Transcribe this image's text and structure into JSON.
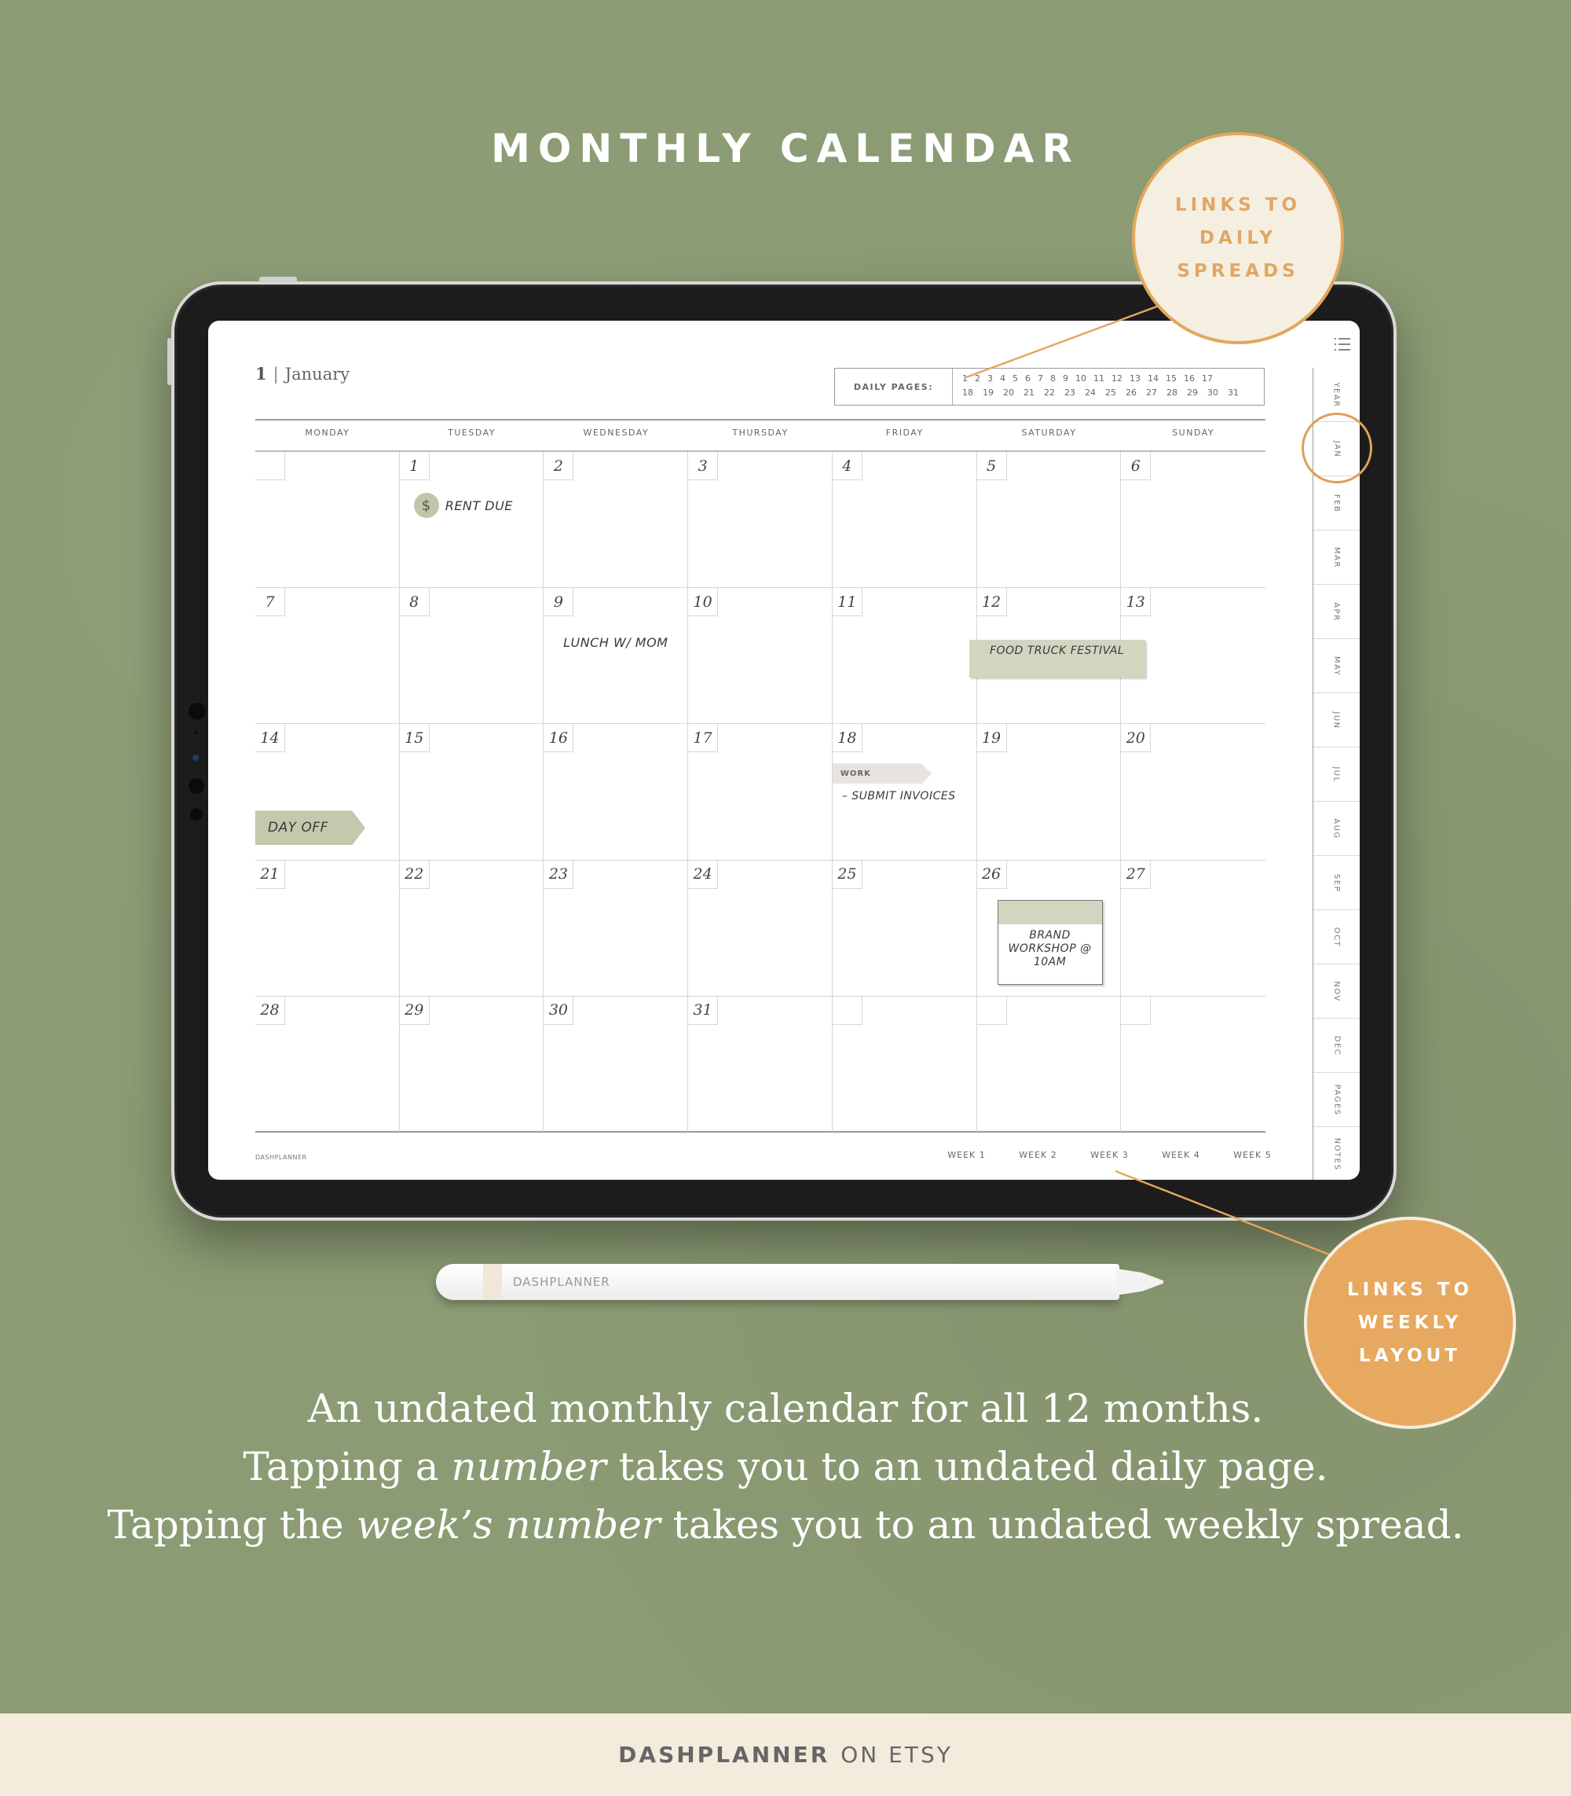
{
  "header": {
    "title": "MONTHLY CALENDAR"
  },
  "colors": {
    "background": "#8b9b73",
    "accent_orange": "#e6a95f",
    "cream": "#f5efe1",
    "sage_tag": "#c5c8ac",
    "footer_bg": "#f3ecdc"
  },
  "planner": {
    "month_number": "1",
    "month_separator": "|",
    "month_name": "January",
    "daily_pages_label": "DAILY PAGES:",
    "daily_pages_row1": [
      "1",
      "2",
      "3",
      "4",
      "5",
      "6",
      "7",
      "8",
      "9",
      "10",
      "11",
      "12",
      "13",
      "14",
      "15",
      "16",
      "17"
    ],
    "daily_pages_row2": [
      "18",
      "19",
      "20",
      "21",
      "22",
      "23",
      "24",
      "25",
      "26",
      "27",
      "28",
      "29",
      "30",
      "31"
    ],
    "weekdays": [
      "MONDAY",
      "TUESDAY",
      "WEDNESDAY",
      "THURSDAY",
      "FRIDAY",
      "SATURDAY",
      "SUNDAY"
    ],
    "days": [
      "",
      "1",
      "2",
      "3",
      "4",
      "5",
      "6",
      "7",
      "8",
      "9",
      "10",
      "11",
      "12",
      "13",
      "14",
      "15",
      "16",
      "17",
      "18",
      "19",
      "20",
      "21",
      "22",
      "23",
      "24",
      "25",
      "26",
      "27",
      "28",
      "29",
      "30",
      "31",
      "",
      "",
      ""
    ],
    "events": {
      "rent_due": {
        "day": "1",
        "icon": "dollar-icon",
        "icon_glyph": "$",
        "text": "RENT DUE"
      },
      "lunch": {
        "day": "9",
        "text": "LUNCH W/ MOM"
      },
      "food_truck": {
        "day": "12",
        "text": "FOOD TRUCK FESTIVAL"
      },
      "day_off": {
        "day": "14",
        "text": "DAY OFF"
      },
      "work": {
        "day": "18",
        "tag": "WORK",
        "text": "– SUBMIT INVOICES"
      },
      "brand_workshop": {
        "day": "26",
        "text": "BRAND WORKSHOP @ 10AM"
      }
    },
    "footer_brand": "DASHPLANNER",
    "week_links": [
      "WEEK 1",
      "WEEK 2",
      "WEEK 3",
      "WEEK 4",
      "WEEK 5"
    ],
    "side_tabs": [
      "YEAR",
      "JAN",
      "FEB",
      "MAR",
      "APR",
      "MAY",
      "JUN",
      "JUL",
      "AUG",
      "SEP",
      "OCT",
      "NOV",
      "DEC",
      "PAGES",
      "NOTES"
    ],
    "active_tab": "JAN",
    "menu_icon": "list-icon"
  },
  "callouts": {
    "daily": [
      "LINKS TO",
      "DAILY",
      "SPREADS"
    ],
    "weekly": [
      "LINKS TO",
      "WEEKLY",
      "LAYOUT"
    ]
  },
  "pencil": {
    "brand_bold": "DASH",
    "brand_rest": "PLANNER"
  },
  "caption": {
    "line1": "An undated monthly calendar for all 12 months.",
    "line2_pre": "Tapping a ",
    "line2_em": "number",
    "line2_post": " takes you to an undated daily page.",
    "line3_pre": "Tapping the ",
    "line3_em": "week’s number",
    "line3_post": " takes you to an undated weekly spread."
  },
  "footer": {
    "brand": "DASHPLANNER",
    "suffix": "ON ETSY"
  }
}
